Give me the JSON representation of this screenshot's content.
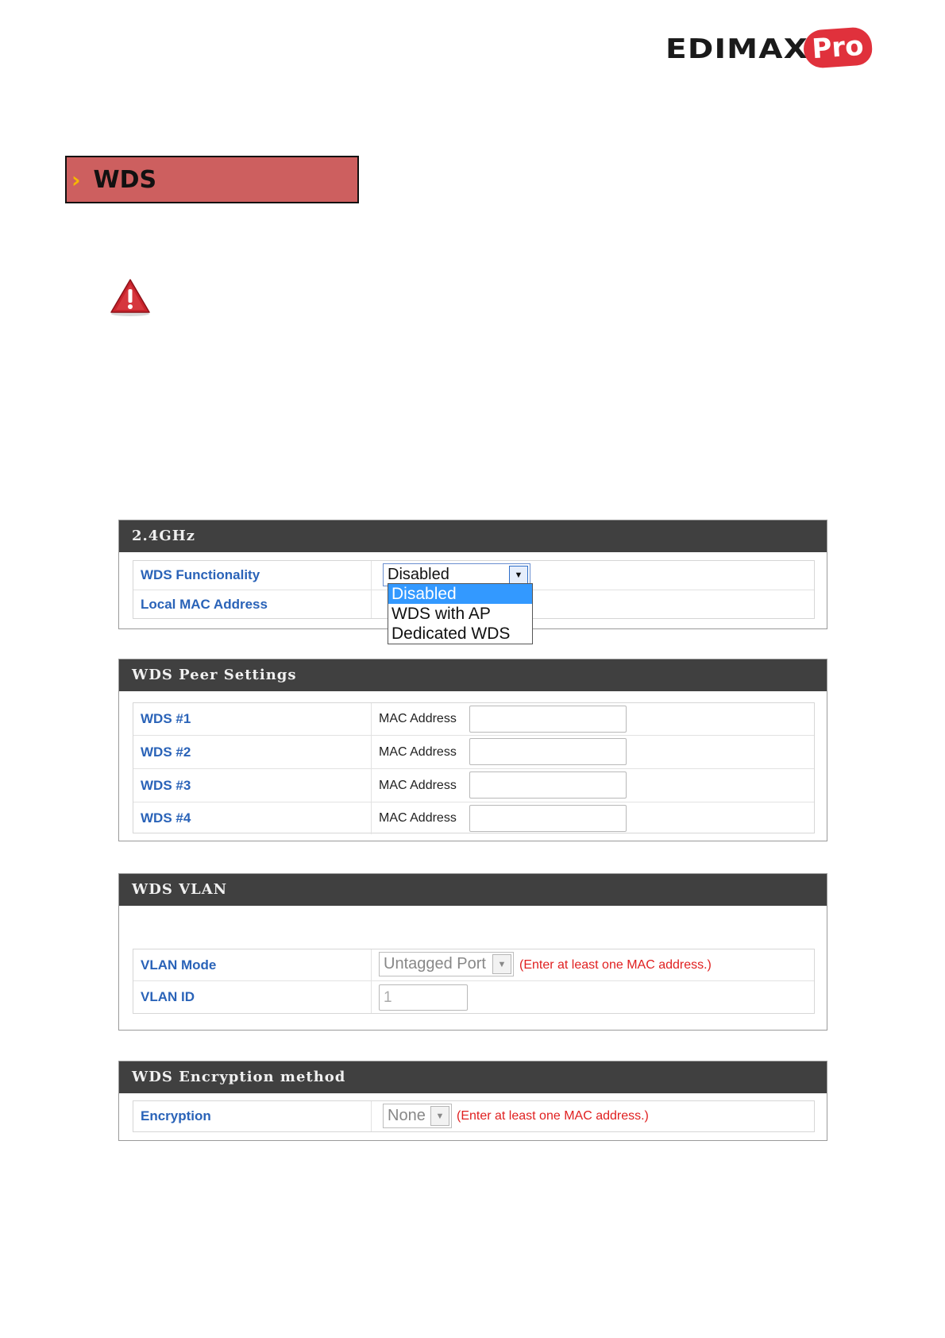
{
  "logo": {
    "text": "EDIMAX",
    "badge": "Pro"
  },
  "section": {
    "title": "WDS",
    "chevron": "›"
  },
  "warning_icon": "warning-triangle-icon",
  "panel_24ghz": {
    "title": "2.4GHz",
    "rows": [
      {
        "label": "WDS Functionality",
        "select_value": "Disabled"
      },
      {
        "label": "Local MAC Address"
      }
    ],
    "dropdown_options": [
      "Disabled",
      "WDS with AP",
      "Dedicated WDS"
    ],
    "dropdown_selected": "Disabled"
  },
  "peer_settings": {
    "title": "WDS Peer Settings",
    "rows": [
      {
        "label": "WDS #1",
        "sub_label": "MAC Address",
        "value": ""
      },
      {
        "label": "WDS #2",
        "sub_label": "MAC Address",
        "value": ""
      },
      {
        "label": "WDS #3",
        "sub_label": "MAC Address",
        "value": ""
      },
      {
        "label": "WDS #4",
        "sub_label": "MAC Address",
        "value": ""
      }
    ]
  },
  "wds_vlan": {
    "title": "WDS VLAN",
    "vlan_mode": {
      "label": "VLAN Mode",
      "value": "Untagged Port",
      "hint": "(Enter at least one MAC address.)"
    },
    "vlan_id": {
      "label": "VLAN ID",
      "value": "1"
    }
  },
  "encryption": {
    "title": "WDS Encryption method",
    "label": "Encryption",
    "value": "None",
    "hint": "(Enter at least one MAC address.)"
  },
  "colors": {
    "section_fill": "#cd5f5f",
    "panel_header": "#404040",
    "label_blue": "#2a63b8",
    "hint_red": "#e02020",
    "dropdown_highlight": "#3399ff"
  }
}
